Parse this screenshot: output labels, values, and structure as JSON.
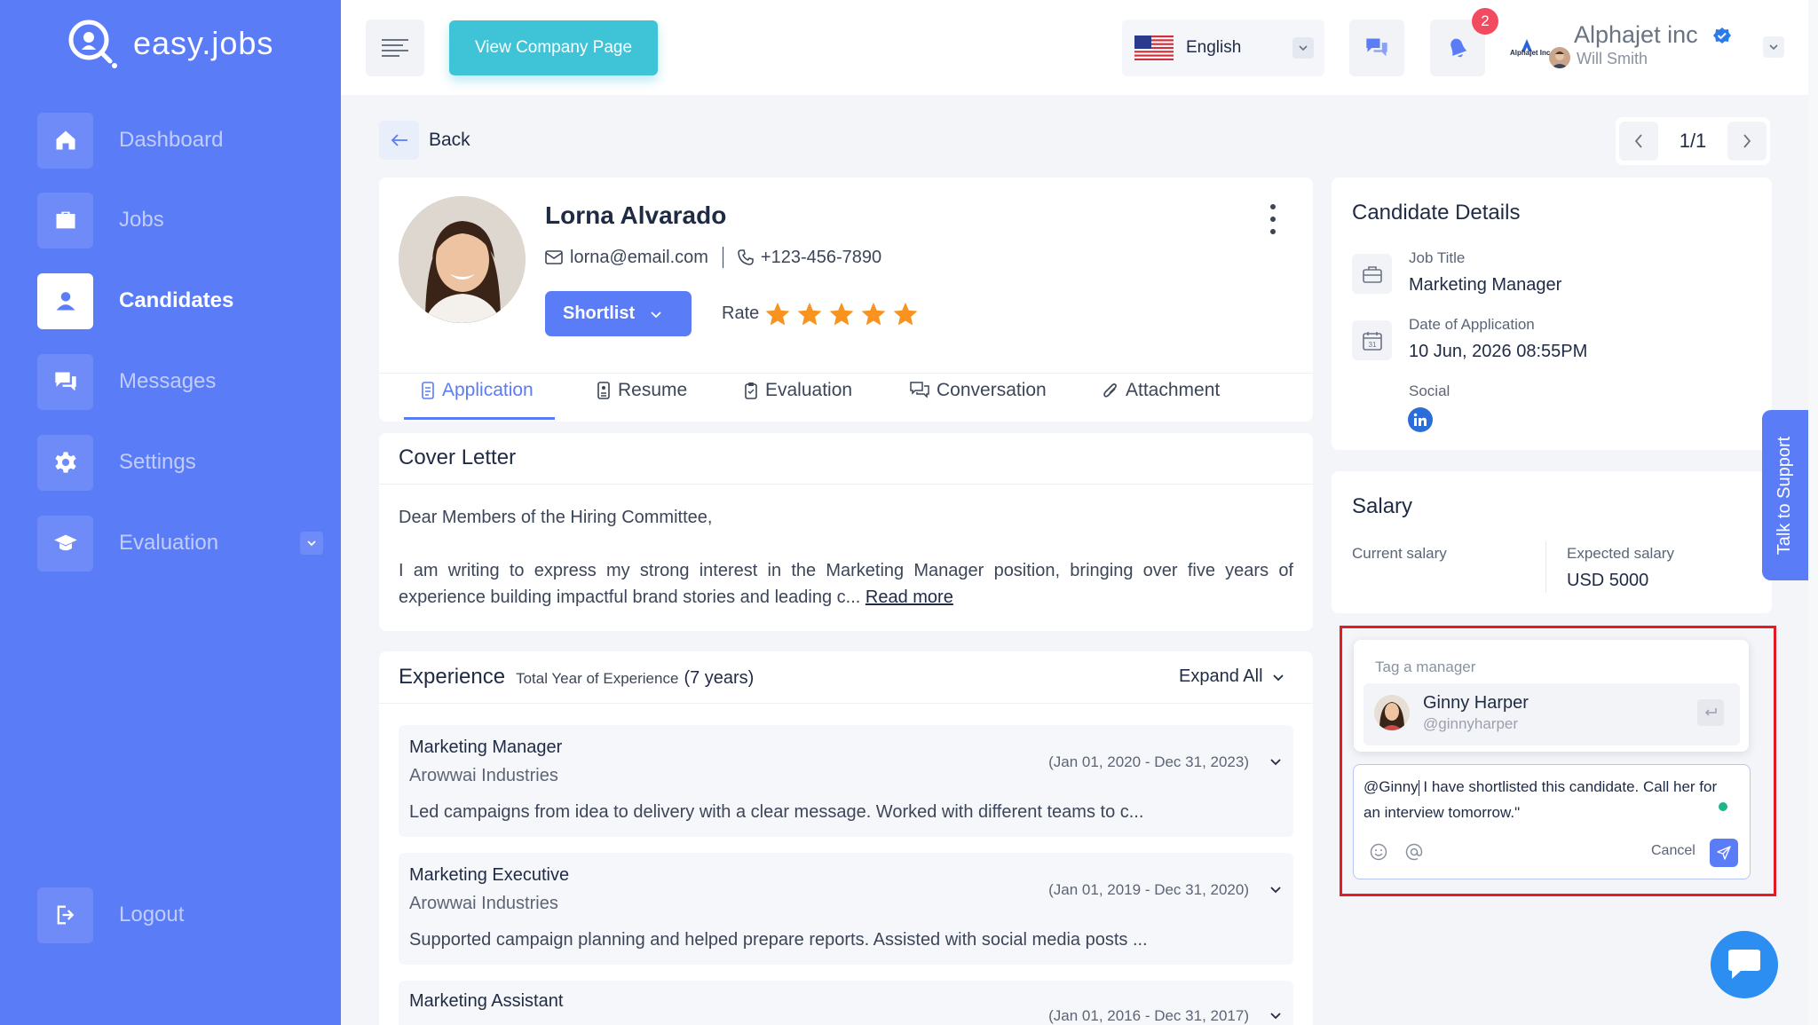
{
  "brand": {
    "name": "easy.jobs",
    "accent": "#5b7cf7",
    "cyan": "#3fc3d7"
  },
  "sidebar": {
    "items": [
      {
        "label": "Dashboard",
        "icon": "home-icon"
      },
      {
        "label": "Jobs",
        "icon": "briefcase-icon"
      },
      {
        "label": "Candidates",
        "icon": "user-icon",
        "active": true
      },
      {
        "label": "Messages",
        "icon": "chat-icon"
      },
      {
        "label": "Settings",
        "icon": "gear-icon"
      },
      {
        "label": "Evaluation",
        "icon": "graduation-cap-icon"
      }
    ],
    "logout": "Logout"
  },
  "topbar": {
    "company_page_button": "View Company Page",
    "language": "English",
    "notification_count": "2",
    "company_name": "Alphajet inc",
    "company_logo_text": "Alphajet Inc",
    "user_name": "Will Smith"
  },
  "nav": {
    "back": "Back",
    "pager": "1/1"
  },
  "candidate": {
    "name": "Lorna Alvarado",
    "email": "lorna@email.com",
    "phone": "+123-456-7890",
    "status_button": "Shortlist",
    "rate_label": "Rate",
    "rating": 5,
    "rating_max": 5
  },
  "tabs": [
    {
      "label": "Application",
      "icon": "document-icon"
    },
    {
      "label": "Resume",
      "icon": "resume-icon"
    },
    {
      "label": "Evaluation",
      "icon": "clipboard-icon"
    },
    {
      "label": "Conversation",
      "icon": "conversation-icon"
    },
    {
      "label": "Attachment",
      "icon": "paperclip-icon"
    }
  ],
  "cover_letter": {
    "title": "Cover Letter",
    "greeting": "Dear Members of the Hiring Committee,",
    "body": "I am writing to express my strong interest in the Marketing Manager position, bringing over five years of experience building impactful brand stories and leading c...",
    "read_more": "Read more"
  },
  "experience": {
    "title": "Experience",
    "total_label": "Total Year of Experience",
    "total_value": "(7 years)",
    "expand_all": "Expand All",
    "items": [
      {
        "role": "Marketing Manager",
        "company": "Arowwai Industries",
        "dates": "(Jan 01, 2020 - Dec 31, 2023)",
        "desc": "Led campaigns from idea to delivery with a clear message. Worked with different teams to c..."
      },
      {
        "role": "Marketing Executive",
        "company": "Arowwai Industries",
        "dates": "(Jan 01, 2019 - Dec 31, 2020)",
        "desc": "Supported campaign planning and helped prepare reports. Assisted with social media posts ..."
      },
      {
        "role": "Marketing Assistant",
        "company": "",
        "dates": "(Jan 01, 2016 - Dec 31, 2017)",
        "desc": ""
      }
    ]
  },
  "details": {
    "title": "Candidate Details",
    "job_title_label": "Job Title",
    "job_title": "Marketing Manager",
    "date_label": "Date of Application",
    "date": "10 Jun, 2026 08:55PM",
    "social_label": "Social"
  },
  "salary": {
    "title": "Salary",
    "current_label": "Current salary",
    "current_value": "",
    "expected_label": "Expected salary",
    "expected_value": "USD 5000"
  },
  "tag": {
    "heading": "Tag a manager",
    "manager_name": "Ginny Harper",
    "manager_handle": "@ginnyharper"
  },
  "comment": {
    "mention": "@Ginny",
    "text": " I have shortlisted this candidate. Call her for an interview tomorrow.\"",
    "cancel": "Cancel"
  },
  "support": {
    "label": "Talk to Support"
  }
}
